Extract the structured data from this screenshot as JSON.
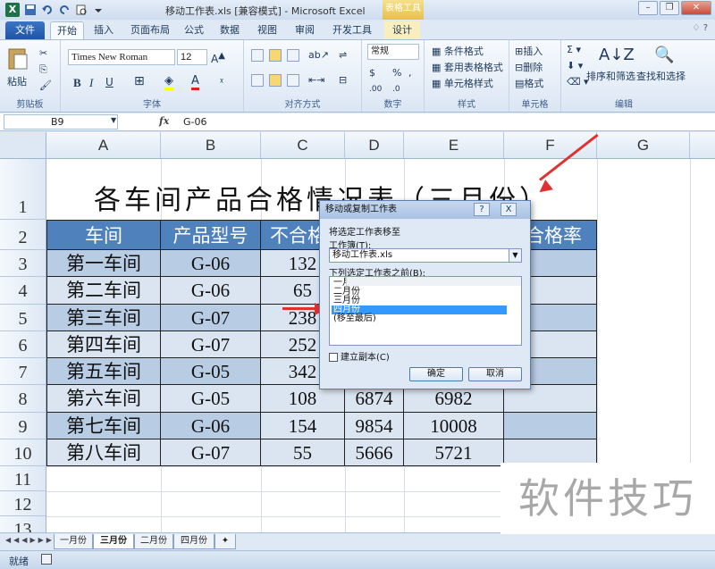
{
  "window": {
    "title": "移动工作表.xls  [兼容模式] - Microsoft Excel",
    "context_tab_group": "表格工具",
    "app_icon": "X"
  },
  "ribbon_tabs": [
    "文件",
    "开始",
    "插入",
    "页面布局",
    "公式",
    "数据",
    "视图",
    "审阅",
    "开发工具",
    "设计"
  ],
  "ribbon": {
    "clipboard": {
      "paste": "粘贴",
      "label": "剪贴板"
    },
    "font": {
      "name": "Times New Roman",
      "size": "12",
      "label": "字体"
    },
    "alignment": {
      "label": "对齐方式"
    },
    "number": {
      "format": "常规",
      "label": "数字"
    },
    "styles": {
      "conditional": "条件格式",
      "table_format": "套用表格格式",
      "cell_styles": "单元格样式",
      "label": "样式"
    },
    "cells": {
      "insert": "插入",
      "delete": "删除",
      "format": "格式",
      "label": "单元格"
    },
    "editing": {
      "sort_filter": "排序和筛选",
      "find_select": "查找和选择",
      "label": "编辑"
    }
  },
  "formula_bar": {
    "name_box": "B9",
    "fx": "fx",
    "value": "G-06"
  },
  "columns": [
    "A",
    "B",
    "C",
    "D",
    "E",
    "F",
    "G"
  ],
  "rows": [
    "1",
    "2",
    "3",
    "4",
    "5",
    "6",
    "7",
    "8",
    "9",
    "10",
    "11",
    "12",
    "13"
  ],
  "sheet": {
    "title": "各车间产品合格情况表（三月份）",
    "headers": [
      "车间",
      "产品型号",
      "不合格",
      "",
      "",
      "合格率"
    ],
    "data": [
      [
        "第一车间",
        "G-06",
        "132",
        "",
        "",
        ""
      ],
      [
        "第二车间",
        "G-06",
        "65",
        "",
        "",
        ""
      ],
      [
        "第三车间",
        "G-07",
        "238",
        "",
        "",
        ""
      ],
      [
        "第四车间",
        "G-07",
        "252",
        "",
        "",
        ""
      ],
      [
        "第五车间",
        "G-05",
        "342",
        "",
        "",
        ""
      ],
      [
        "第六车间",
        "G-05",
        "108",
        "6874",
        "6982",
        ""
      ],
      [
        "第七车间",
        "G-06",
        "154",
        "9854",
        "10008",
        ""
      ],
      [
        "第八车间",
        "G-07",
        "55",
        "5666",
        "5721",
        ""
      ]
    ]
  },
  "dialog": {
    "title": "移动或复制工作表",
    "help": "?",
    "close": "X",
    "move_to_label": "将选定工作表移至",
    "workbook_label": "工作簿(T):",
    "workbook_value": "移动工作表.xls",
    "before_label": "下列选定工作表之前(B):",
    "sheets": [
      "一月份",
      "二月份",
      "三月份",
      "四月份",
      "(移至最后)"
    ],
    "selected_index": 3,
    "copy_label": "建立副本(C)",
    "ok": "确定",
    "cancel": "取消"
  },
  "sheet_tabs": [
    "一月份",
    "三月份",
    "二月份",
    "四月份"
  ],
  "active_sheet_tab": "三月份",
  "status": {
    "ready": "就绪"
  },
  "watermark": "软件技巧",
  "colors": {
    "header_fill": "#4f81bd",
    "band_dark": "#b8cce4",
    "band_light": "#dbe5f1",
    "arrow": "#e03030",
    "selection": "#3399ff"
  }
}
